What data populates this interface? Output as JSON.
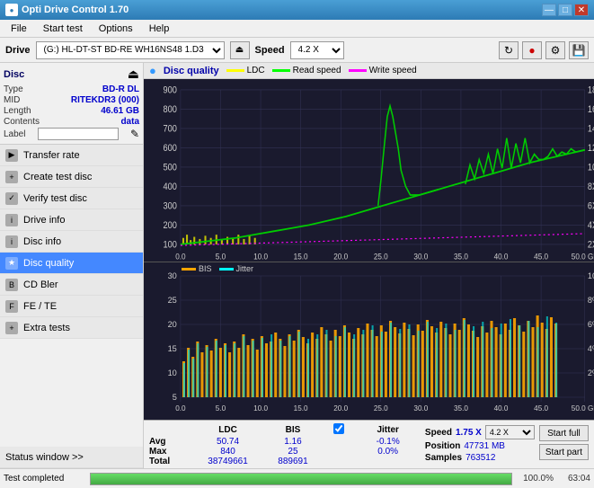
{
  "titleBar": {
    "title": "Opti Drive Control 1.70",
    "minimize": "—",
    "maximize": "□",
    "close": "✕"
  },
  "menuBar": {
    "items": [
      "File",
      "Start test",
      "Options",
      "Help"
    ]
  },
  "driveBar": {
    "label": "Drive",
    "driveValue": "(G:)  HL-DT-ST BD-RE  WH16NS48 1.D3",
    "speedLabel": "Speed",
    "speedValue": "4.2 X"
  },
  "disc": {
    "title": "Disc",
    "typeLabel": "Type",
    "typeValue": "BD-R DL",
    "midLabel": "MID",
    "midValue": "RITEKDR3 (000)",
    "lengthLabel": "Length",
    "lengthValue": "46.61 GB",
    "contentsLabel": "Contents",
    "contentsValue": "data",
    "labelLabel": "Label",
    "labelValue": ""
  },
  "navItems": [
    {
      "id": "transfer-rate",
      "label": "Transfer rate",
      "active": false
    },
    {
      "id": "create-test-disc",
      "label": "Create test disc",
      "active": false
    },
    {
      "id": "verify-test-disc",
      "label": "Verify test disc",
      "active": false
    },
    {
      "id": "drive-info",
      "label": "Drive info",
      "active": false
    },
    {
      "id": "disc-info",
      "label": "Disc info",
      "active": false
    },
    {
      "id": "disc-quality",
      "label": "Disc quality",
      "active": true
    },
    {
      "id": "cd-bler",
      "label": "CD Bler",
      "active": false
    },
    {
      "id": "fe-te",
      "label": "FE / TE",
      "active": false
    },
    {
      "id": "extra-tests",
      "label": "Extra tests",
      "active": false
    }
  ],
  "statusWindow": {
    "label": "Status window >>"
  },
  "chartHeader": {
    "title": "Disc quality",
    "legends": [
      {
        "id": "ldc",
        "label": "LDC",
        "color": "#ffff00"
      },
      {
        "id": "read-speed",
        "label": "Read speed",
        "color": "#00ff00"
      },
      {
        "id": "write-speed",
        "label": "Write speed",
        "color": "#ff00ff"
      }
    ]
  },
  "chartBottom": {
    "legends": [
      {
        "id": "bis",
        "label": "BIS",
        "color": "#ffa500"
      },
      {
        "id": "jitter",
        "label": "Jitter",
        "color": "#00ffff"
      }
    ]
  },
  "stats": {
    "headers": [
      "LDC",
      "BIS",
      "",
      "Jitter",
      "Speed",
      ""
    ],
    "avgLabel": "Avg",
    "avgLdc": "50.74",
    "avgBis": "1.16",
    "avgJitter": "-0.1%",
    "maxLabel": "Max",
    "maxLdc": "840",
    "maxBis": "25",
    "maxJitter": "0.0%",
    "totalLabel": "Total",
    "totalLdc": "38749661",
    "totalBis": "889691",
    "speedValue": "1.75 X",
    "speedDropdown": "4.2 X",
    "positionLabel": "Position",
    "positionValue": "47731 MB",
    "samplesLabel": "Samples",
    "samplesValue": "763512",
    "startFullBtn": "Start full",
    "startPartBtn": "Start part"
  },
  "progress": {
    "statusText": "Test completed",
    "percent": "100.0%",
    "time": "63:04",
    "fillPercent": 100
  },
  "chartTopYLabels": [
    "900",
    "800",
    "700",
    "600",
    "500",
    "400",
    "300",
    "200",
    "100"
  ],
  "chartTopY2Labels": [
    "18X",
    "16X",
    "14X",
    "12X",
    "10X",
    "8X",
    "6X",
    "4X",
    "2X"
  ],
  "chartTopXLabels": [
    "0.0",
    "5.0",
    "10.0",
    "15.0",
    "20.0",
    "25.0",
    "30.0",
    "35.0",
    "40.0",
    "45.0",
    "50.0 GB"
  ],
  "chartBotYLabels": [
    "30",
    "25",
    "20",
    "15",
    "10",
    "5"
  ],
  "chartBotY2Labels": [
    "10%",
    "8%",
    "6%",
    "4%",
    "2%"
  ],
  "chartBotXLabels": [
    "0.0",
    "5.0",
    "10.0",
    "15.0",
    "20.0",
    "25.0",
    "30.0",
    "35.0",
    "40.0",
    "45.0",
    "50.0 GB"
  ]
}
